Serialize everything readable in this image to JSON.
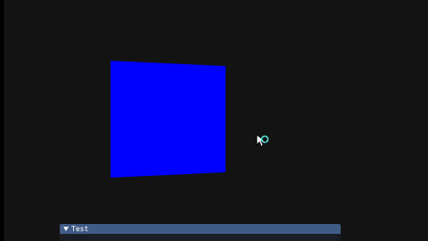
{
  "window": {
    "title": "Test",
    "collapsed_state": "expanded"
  },
  "scene": {
    "background_color": "#131313",
    "quad_color": "#0000ff",
    "cursor": "busy-cursor-icon"
  },
  "icons": {
    "collapse": "collapse-triangle-icon"
  }
}
